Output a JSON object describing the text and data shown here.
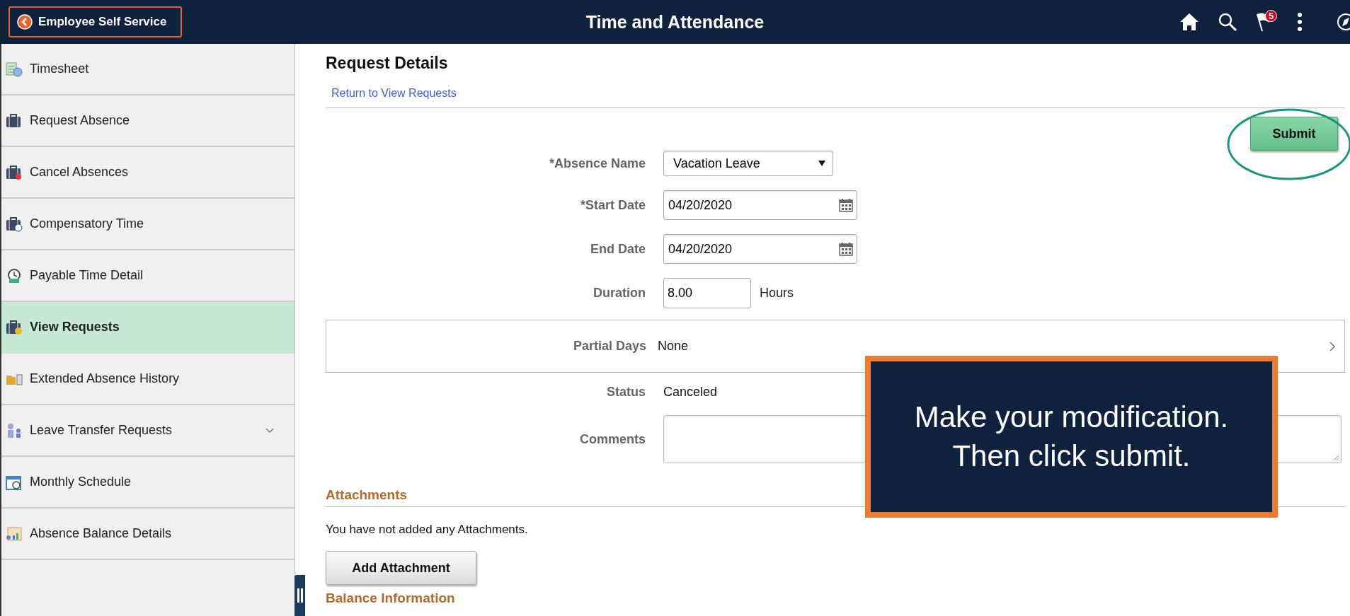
{
  "header": {
    "back_button": "Employee Self Service",
    "title": "Time and Attendance",
    "notification_count": "5"
  },
  "sidebar": {
    "items": [
      {
        "label": "Timesheet",
        "selected": false,
        "expandable": false
      },
      {
        "label": "Request Absence",
        "selected": false,
        "expandable": false
      },
      {
        "label": "Cancel Absences",
        "selected": false,
        "expandable": false
      },
      {
        "label": "Compensatory Time",
        "selected": false,
        "expandable": false
      },
      {
        "label": "Payable Time Detail",
        "selected": false,
        "expandable": false
      },
      {
        "label": "View Requests",
        "selected": true,
        "expandable": false
      },
      {
        "label": "Extended Absence History",
        "selected": false,
        "expandable": false
      },
      {
        "label": "Leave Transfer Requests",
        "selected": false,
        "expandable": true
      },
      {
        "label": "Monthly Schedule",
        "selected": false,
        "expandable": false
      },
      {
        "label": "Absence Balance Details",
        "selected": false,
        "expandable": false
      }
    ]
  },
  "page": {
    "title": "Request Details",
    "return_link": "Return to View Requests",
    "submit_button": "Submit",
    "form": {
      "absence_name": {
        "label": "*Absence Name",
        "value": "Vacation Leave"
      },
      "start_date": {
        "label": "*Start Date",
        "value": "04/20/2020"
      },
      "end_date": {
        "label": "End Date",
        "value": "04/20/2020"
      },
      "duration": {
        "label": "Duration",
        "value": "8.00",
        "unit": "Hours"
      },
      "partial_days": {
        "label": "Partial Days",
        "value": "None"
      },
      "status": {
        "label": "Status",
        "value": "Canceled"
      },
      "comments": {
        "label": "Comments"
      }
    },
    "attachments": {
      "heading": "Attachments",
      "message": "You have not added any Attachments.",
      "button": "Add Attachment"
    },
    "balance_heading": "Balance Information"
  },
  "callout": {
    "lines": [
      "Make your modification.",
      "Then click submit."
    ]
  }
}
